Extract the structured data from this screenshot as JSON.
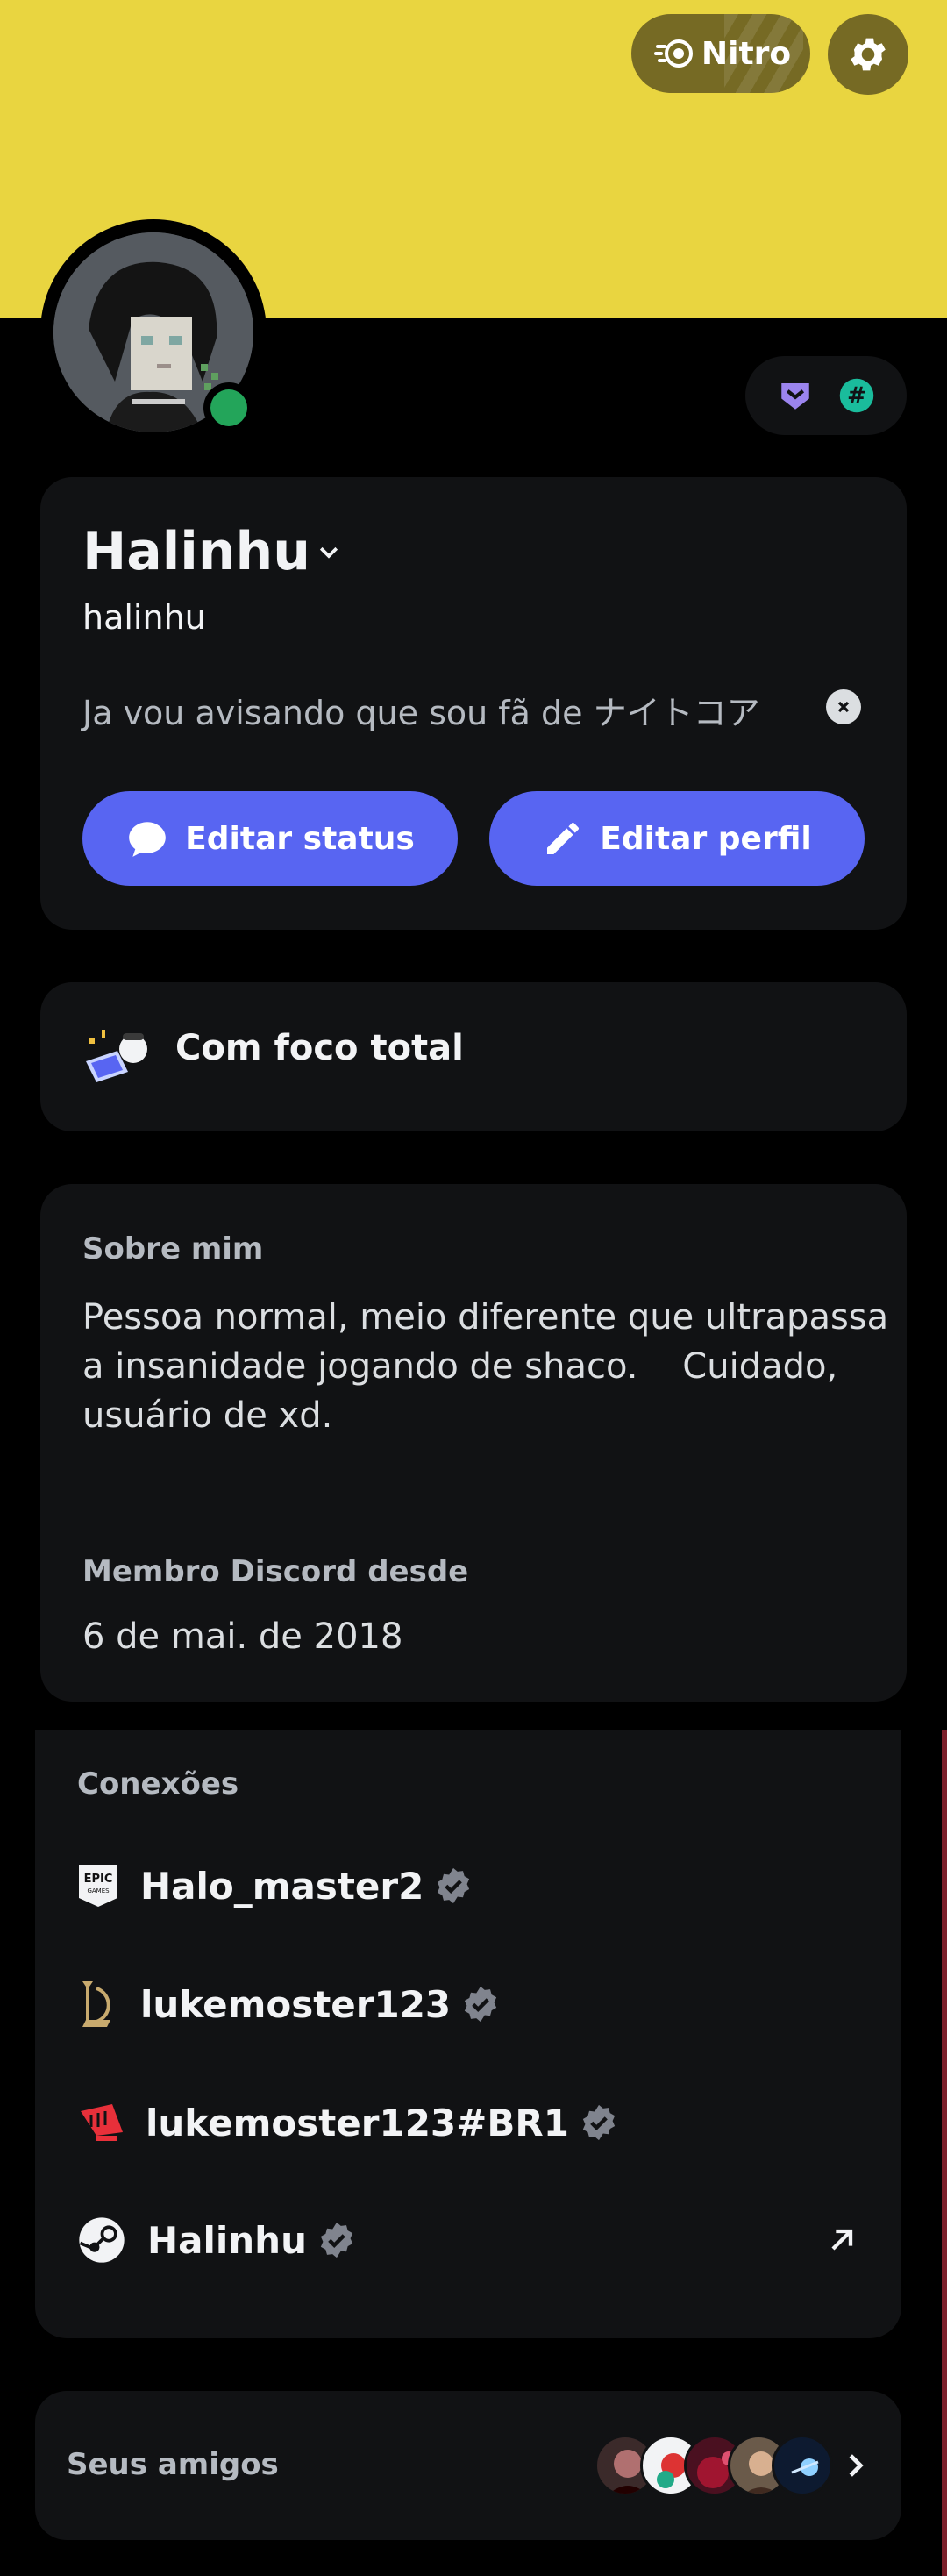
{
  "header": {
    "nitro_label": "Nitro",
    "banner_color": "#e9d540",
    "button_bg": "#766a24"
  },
  "profile": {
    "display_name": "Halinhu",
    "username": "halinhu",
    "custom_status": "Ja vou avisando que sou fã de ナイトコア",
    "status": "online",
    "edit_status_label": "Editar status",
    "edit_profile_label": "Editar perfil",
    "accent_color": "#5865f2"
  },
  "activity": {
    "label": "Com foco total"
  },
  "about": {
    "heading": "Sobre mim",
    "lines": [
      "Pessoa normal, meio diferente que ultrapassa",
      "a insanidade jogando de shaco.    Cuidado,",
      "usuário de xd."
    ],
    "member_heading": "Membro Discord desde",
    "member_since": "6 de mai. de 2018"
  },
  "connections": {
    "heading": "Conexões",
    "items": [
      {
        "service": "epic-games",
        "name": "Halo_master2",
        "verified": true
      },
      {
        "service": "league-of-legends",
        "name": "lukemoster123",
        "verified": true
      },
      {
        "service": "riot-games",
        "name": "lukemoster123#BR1",
        "verified": true
      },
      {
        "service": "steam",
        "name": "Halinhu",
        "verified": true,
        "external_link": true
      }
    ]
  },
  "friends": {
    "label": "Seus amigos"
  }
}
